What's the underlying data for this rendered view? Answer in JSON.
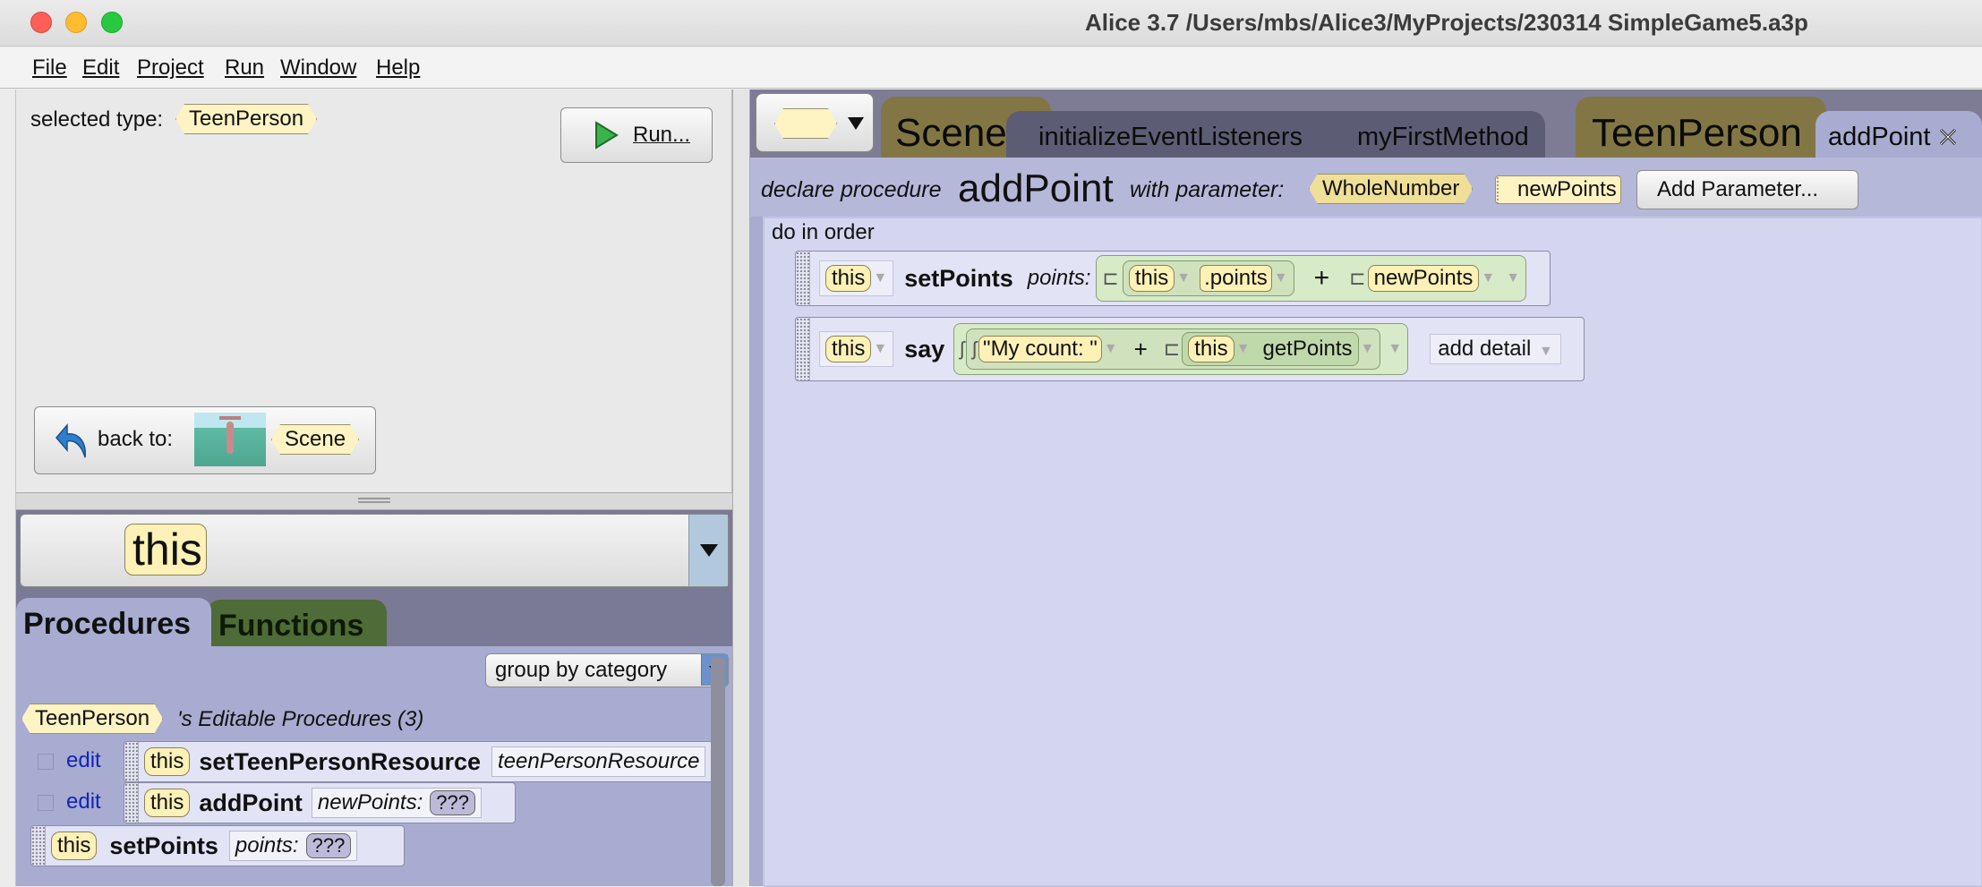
{
  "window": {
    "title": "Alice 3.7 /Users/mbs/Alice3/MyProjects/230314 SimpleGame5.a3p"
  },
  "menubar": [
    {
      "label": "File"
    },
    {
      "label": "Edit"
    },
    {
      "label": "Project"
    },
    {
      "label": "Run"
    },
    {
      "label": "Window"
    },
    {
      "label": "Help"
    }
  ],
  "scene_panel": {
    "selected_type_label": "selected type:",
    "selected_type": "TeenPerson",
    "run_button": "Run...",
    "back_to_label": "back to:",
    "back_to_target": "Scene"
  },
  "instance_selector": {
    "value": "this"
  },
  "palette": {
    "tabs": [
      {
        "label": "Procedures"
      },
      {
        "label": "Functions"
      }
    ],
    "group_by": "group by category",
    "category": {
      "type": "TeenPerson",
      "title": "'s Editable Procedures (3)"
    },
    "edit_label": "edit",
    "procedures": [
      {
        "target": "this",
        "name": "setTeenPersonResource",
        "param": "teenPersonResource"
      },
      {
        "target": "this",
        "name": "addPoint",
        "param": "newPoints:",
        "value": "???"
      },
      {
        "target": "this",
        "name": "setPoints",
        "param": "points:",
        "value": "???"
      }
    ]
  },
  "editor_tabs": {
    "class_selector": "",
    "tabs": [
      {
        "label": "Scene"
      },
      {
        "label": "initializeEventListeners"
      },
      {
        "label": "myFirstMethod"
      },
      {
        "label": "TeenPerson"
      },
      {
        "label": "addPoint"
      }
    ]
  },
  "declaration": {
    "prefix": "declare procedure",
    "name": "addPoint",
    "with": "with parameter:",
    "param_type": "WholeNumber",
    "param_name": "newPoints",
    "add_param_button": "Add Parameter..."
  },
  "code": {
    "block": "do in order",
    "statement1": {
      "target": "this",
      "method": "setPoints",
      "arg_label": "points:",
      "left_target": "this",
      "left_member": ".points",
      "operator": "+",
      "right": "newPoints"
    },
    "statement2": {
      "target": "this",
      "method": "say",
      "literal": "\"My count: \"",
      "operator": "+",
      "fn_target": "this",
      "fn_name": "getPoints",
      "detail": "add detail"
    }
  }
}
